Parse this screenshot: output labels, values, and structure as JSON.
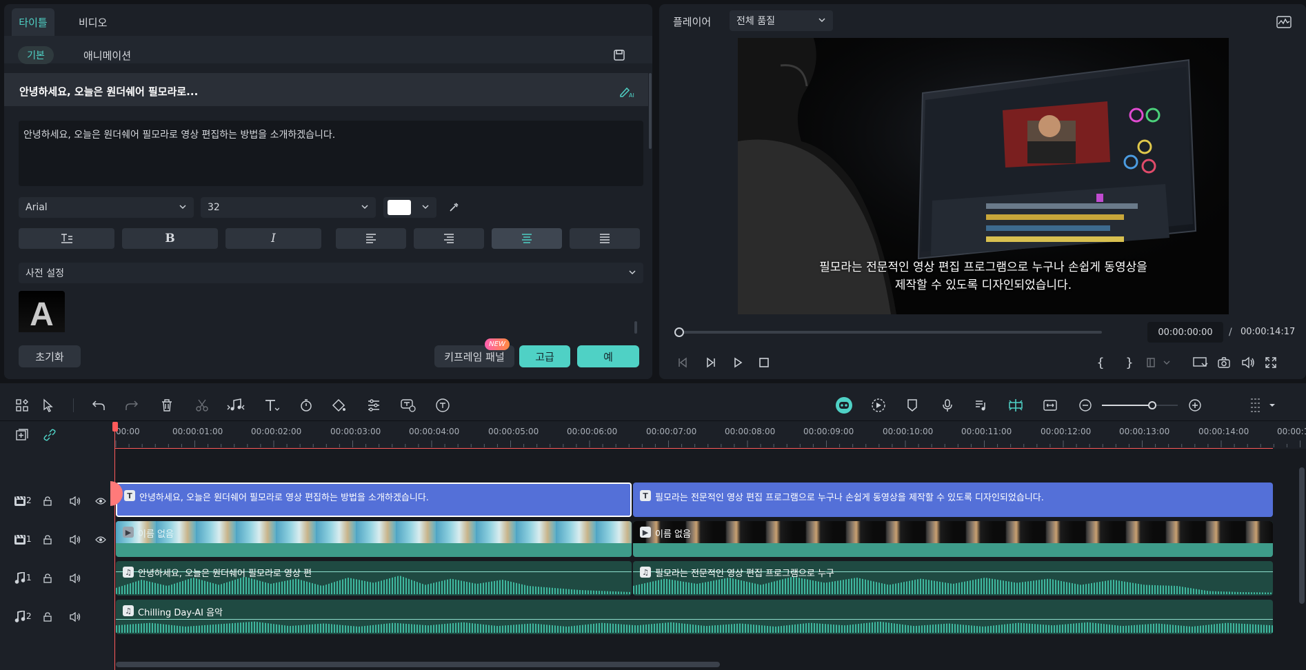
{
  "editor": {
    "tabs": [
      "타이틀",
      "비디오"
    ],
    "subtabs": [
      "기본",
      "애니메이션"
    ],
    "title_heading": "안녕하세요, 오늘은 원더쉐어 필모라로...",
    "text_content": "안녕하세요, 오늘은 원더쉐어 필모라로 영상 편집하는 방법을 소개하겠습니다.",
    "font_family": "Arial",
    "font_size": "32",
    "text_color": "#ffffff",
    "preset_label": "사전 설정",
    "preset_thumb_letter": "A",
    "reset_label": "초기화",
    "keyframe_label": "키프레임 패널",
    "new_badge": "NEW",
    "advanced_label": "고급",
    "ok_label": "예"
  },
  "player": {
    "label": "플레이어",
    "quality": "전체 품질",
    "subtitle_line1": "필모라는 전문적인 영상 편집 프로그램으로 누구나 손쉽게 동영상을",
    "subtitle_line2": "제작할 수 있도록 디자인되었습니다.",
    "current_time": "00:00:00:00",
    "separator": "/",
    "total_time": "00:00:14:17",
    "progress": 0
  },
  "timeline": {
    "ruler": [
      "00:00",
      "00:00:01:00",
      "00:00:02:00",
      "00:00:03:00",
      "00:00:04:00",
      "00:00:05:00",
      "00:00:06:00",
      "00:00:07:00",
      "00:00:08:00",
      "00:00:09:00",
      "00:00:10:00",
      "00:00:11:00",
      "00:00:12:00",
      "00:00:13:00",
      "00:00:14:00",
      "00:00:15:"
    ],
    "tracks": [
      {
        "icon": "video-track-icon",
        "num": "2"
      },
      {
        "icon": "video-track-icon",
        "num": "1"
      },
      {
        "icon": "music-track-icon",
        "num": "1"
      },
      {
        "icon": "music-track-icon",
        "num": "2"
      }
    ],
    "title_clip_1": "안녕하세요, 오늘은 원더쉐어 필모라로 영상 편집하는 방법을 소개하겠습니다.",
    "title_clip_2": "필모라는 전문적인 영상 편집 프로그램으로 누구나 손쉽게 동영상을 제작할 수 있도록 디자인되었습니다.",
    "video_clip_1": "이름 없음",
    "video_clip_2": "이름 없음",
    "audio_clip_1": "안녕하세요, 오늘은 원더쉐어 필모라로 영상 편",
    "audio_clip_2": "필모라는 전문적인 영상 편집 프로그램으로 누구",
    "music_clip": "Chilling Day-AI 음악",
    "zoom": 0.66
  },
  "colors": {
    "accent": "#4fd1c5",
    "title_clip": "#5470d8",
    "video_clip": "#3e9c8a",
    "audio_clip": "#1f4a42",
    "playhead": "#ff5a5a"
  }
}
